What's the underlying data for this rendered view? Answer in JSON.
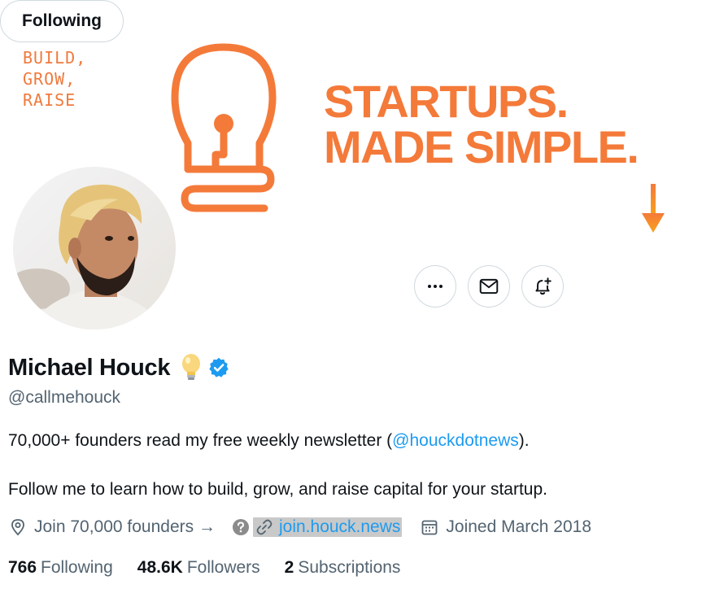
{
  "banner": {
    "tagline": [
      "BUILD,",
      "GROW,",
      "RAISE"
    ],
    "headline_1": "STARTUPS.",
    "headline_2": "MADE SIMPLE.",
    "accent_color": "#f47a3a"
  },
  "actions": {
    "more_icon": "more-horizontal-icon",
    "message_icon": "envelope-icon",
    "notify_icon": "bell-plus-icon",
    "following_label": "Following"
  },
  "profile": {
    "display_name": "Michael Houck",
    "name_emoji": "💡",
    "verified": true,
    "handle": "@callmehouck",
    "bio_line_1_prefix": "70,000+ founders read my free weekly newsletter (",
    "bio_mention": "@houckdotnews",
    "bio_line_1_suffix": ").",
    "bio_line_2": "Follow me to learn how to build, grow, and raise capital for your startup.",
    "location": "Join 70,000 founders →",
    "website": "join.houck.news",
    "joined": "Joined March 2018"
  },
  "stats": {
    "following_count": "766",
    "following_label": "Following",
    "followers_count": "48.6K",
    "followers_label": "Followers",
    "subscriptions_count": "2",
    "subscriptions_label": "Subscriptions"
  },
  "colors": {
    "link": "#1d9bf0",
    "verified": "#1d9bf0",
    "secondary_text": "#536471",
    "border": "#cfd9de"
  }
}
